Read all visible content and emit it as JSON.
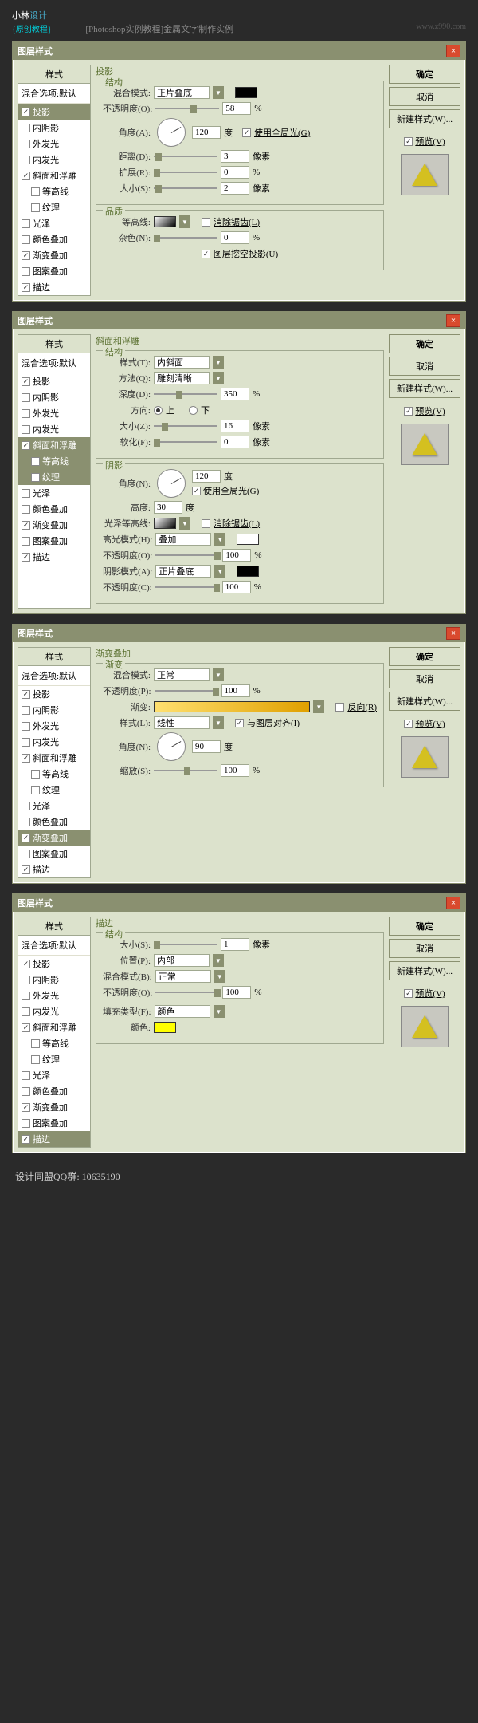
{
  "header": {
    "logo": "小林",
    "logo2": "设计",
    "sub": "{原创教程}",
    "title": "[Photoshop实例教程]金属文字制作实例",
    "url": "www.z990.com"
  },
  "common": {
    "dlg_title": "图层样式",
    "styles_hdr": "样式",
    "blend_opt": "混合选项:默认",
    "ok": "确定",
    "cancel": "取消",
    "new_style": "新建样式(W)...",
    "preview": "预览(V)"
  },
  "styles": {
    "drop_shadow": "投影",
    "inner_shadow": "内阴影",
    "outer_glow": "外发光",
    "inner_glow": "内发光",
    "bevel": "斜面和浮雕",
    "contour": "等高线",
    "texture": "纹理",
    "satin": "光泽",
    "color_overlay": "颜色叠加",
    "gradient_overlay": "渐变叠加",
    "pattern_overlay": "图案叠加",
    "stroke": "描边"
  },
  "d1": {
    "title": "投影",
    "struct": "结构",
    "quality": "品质",
    "blend_mode": "混合模式:",
    "mode_val": "正片叠底",
    "opacity": "不透明度(O):",
    "opacity_val": "58",
    "pct": "%",
    "angle": "角度(A):",
    "angle_val": "120",
    "deg": "度",
    "use_global": "使用全局光(G)",
    "distance": "距离(D):",
    "distance_val": "3",
    "px": "像素",
    "spread": "扩展(R):",
    "spread_val": "0",
    "size": "大小(S):",
    "size_val": "2",
    "contour_lbl": "等高线:",
    "antialias": "消除锯齿(L)",
    "noise": "杂色(N):",
    "noise_val": "0",
    "knockout": "图层挖空投影(U)"
  },
  "d2": {
    "title": "斜面和浮雕",
    "struct": "结构",
    "shading": "阴影",
    "style": "样式(T):",
    "style_val": "内斜面",
    "technique": "方法(Q):",
    "technique_val": "雕刻清晰",
    "depth": "深度(D):",
    "depth_val": "350",
    "pct": "%",
    "direction": "方向:",
    "up": "上",
    "down": "下",
    "size": "大小(Z):",
    "size_val": "16",
    "px": "像素",
    "soften": "软化(F):",
    "soften_val": "0",
    "angle": "角度(N):",
    "angle_val": "120",
    "deg": "度",
    "use_global": "使用全局光(G)",
    "altitude": "高度:",
    "altitude_val": "30",
    "gloss_contour": "光泽等高线:",
    "antialias": "消除锯齿(L)",
    "hl_mode": "高光模式(H):",
    "hl_val": "叠加",
    "hl_op": "不透明度(O):",
    "hl_op_val": "100",
    "sh_mode": "阴影模式(A):",
    "sh_val": "正片叠底",
    "sh_op": "不透明度(C):",
    "sh_op_val": "100"
  },
  "d3": {
    "title": "渐变叠加",
    "grad": "渐变",
    "blend_mode": "混合模式:",
    "mode_val": "正常",
    "opacity": "不透明度(P):",
    "opacity_val": "100",
    "pct": "%",
    "gradient": "渐变:",
    "reverse": "反向(R)",
    "style": "样式(L):",
    "style_val": "线性",
    "align": "与图层对齐(I)",
    "angle": "角度(N):",
    "angle_val": "90",
    "deg": "度",
    "scale": "缩放(S):",
    "scale_val": "100"
  },
  "d4": {
    "title": "描边",
    "struct": "结构",
    "size": "大小(S):",
    "size_val": "1",
    "px": "像素",
    "position": "位置(P):",
    "position_val": "内部",
    "blend_mode": "混合模式(B):",
    "mode_val": "正常",
    "opacity": "不透明度(O):",
    "opacity_val": "100",
    "pct": "%",
    "fill_type": "填充类型(F):",
    "fill_val": "颜色",
    "color": "颜色:",
    "color_val": "#ffff00"
  },
  "footer": "设计同盟QQ群: 10635190"
}
